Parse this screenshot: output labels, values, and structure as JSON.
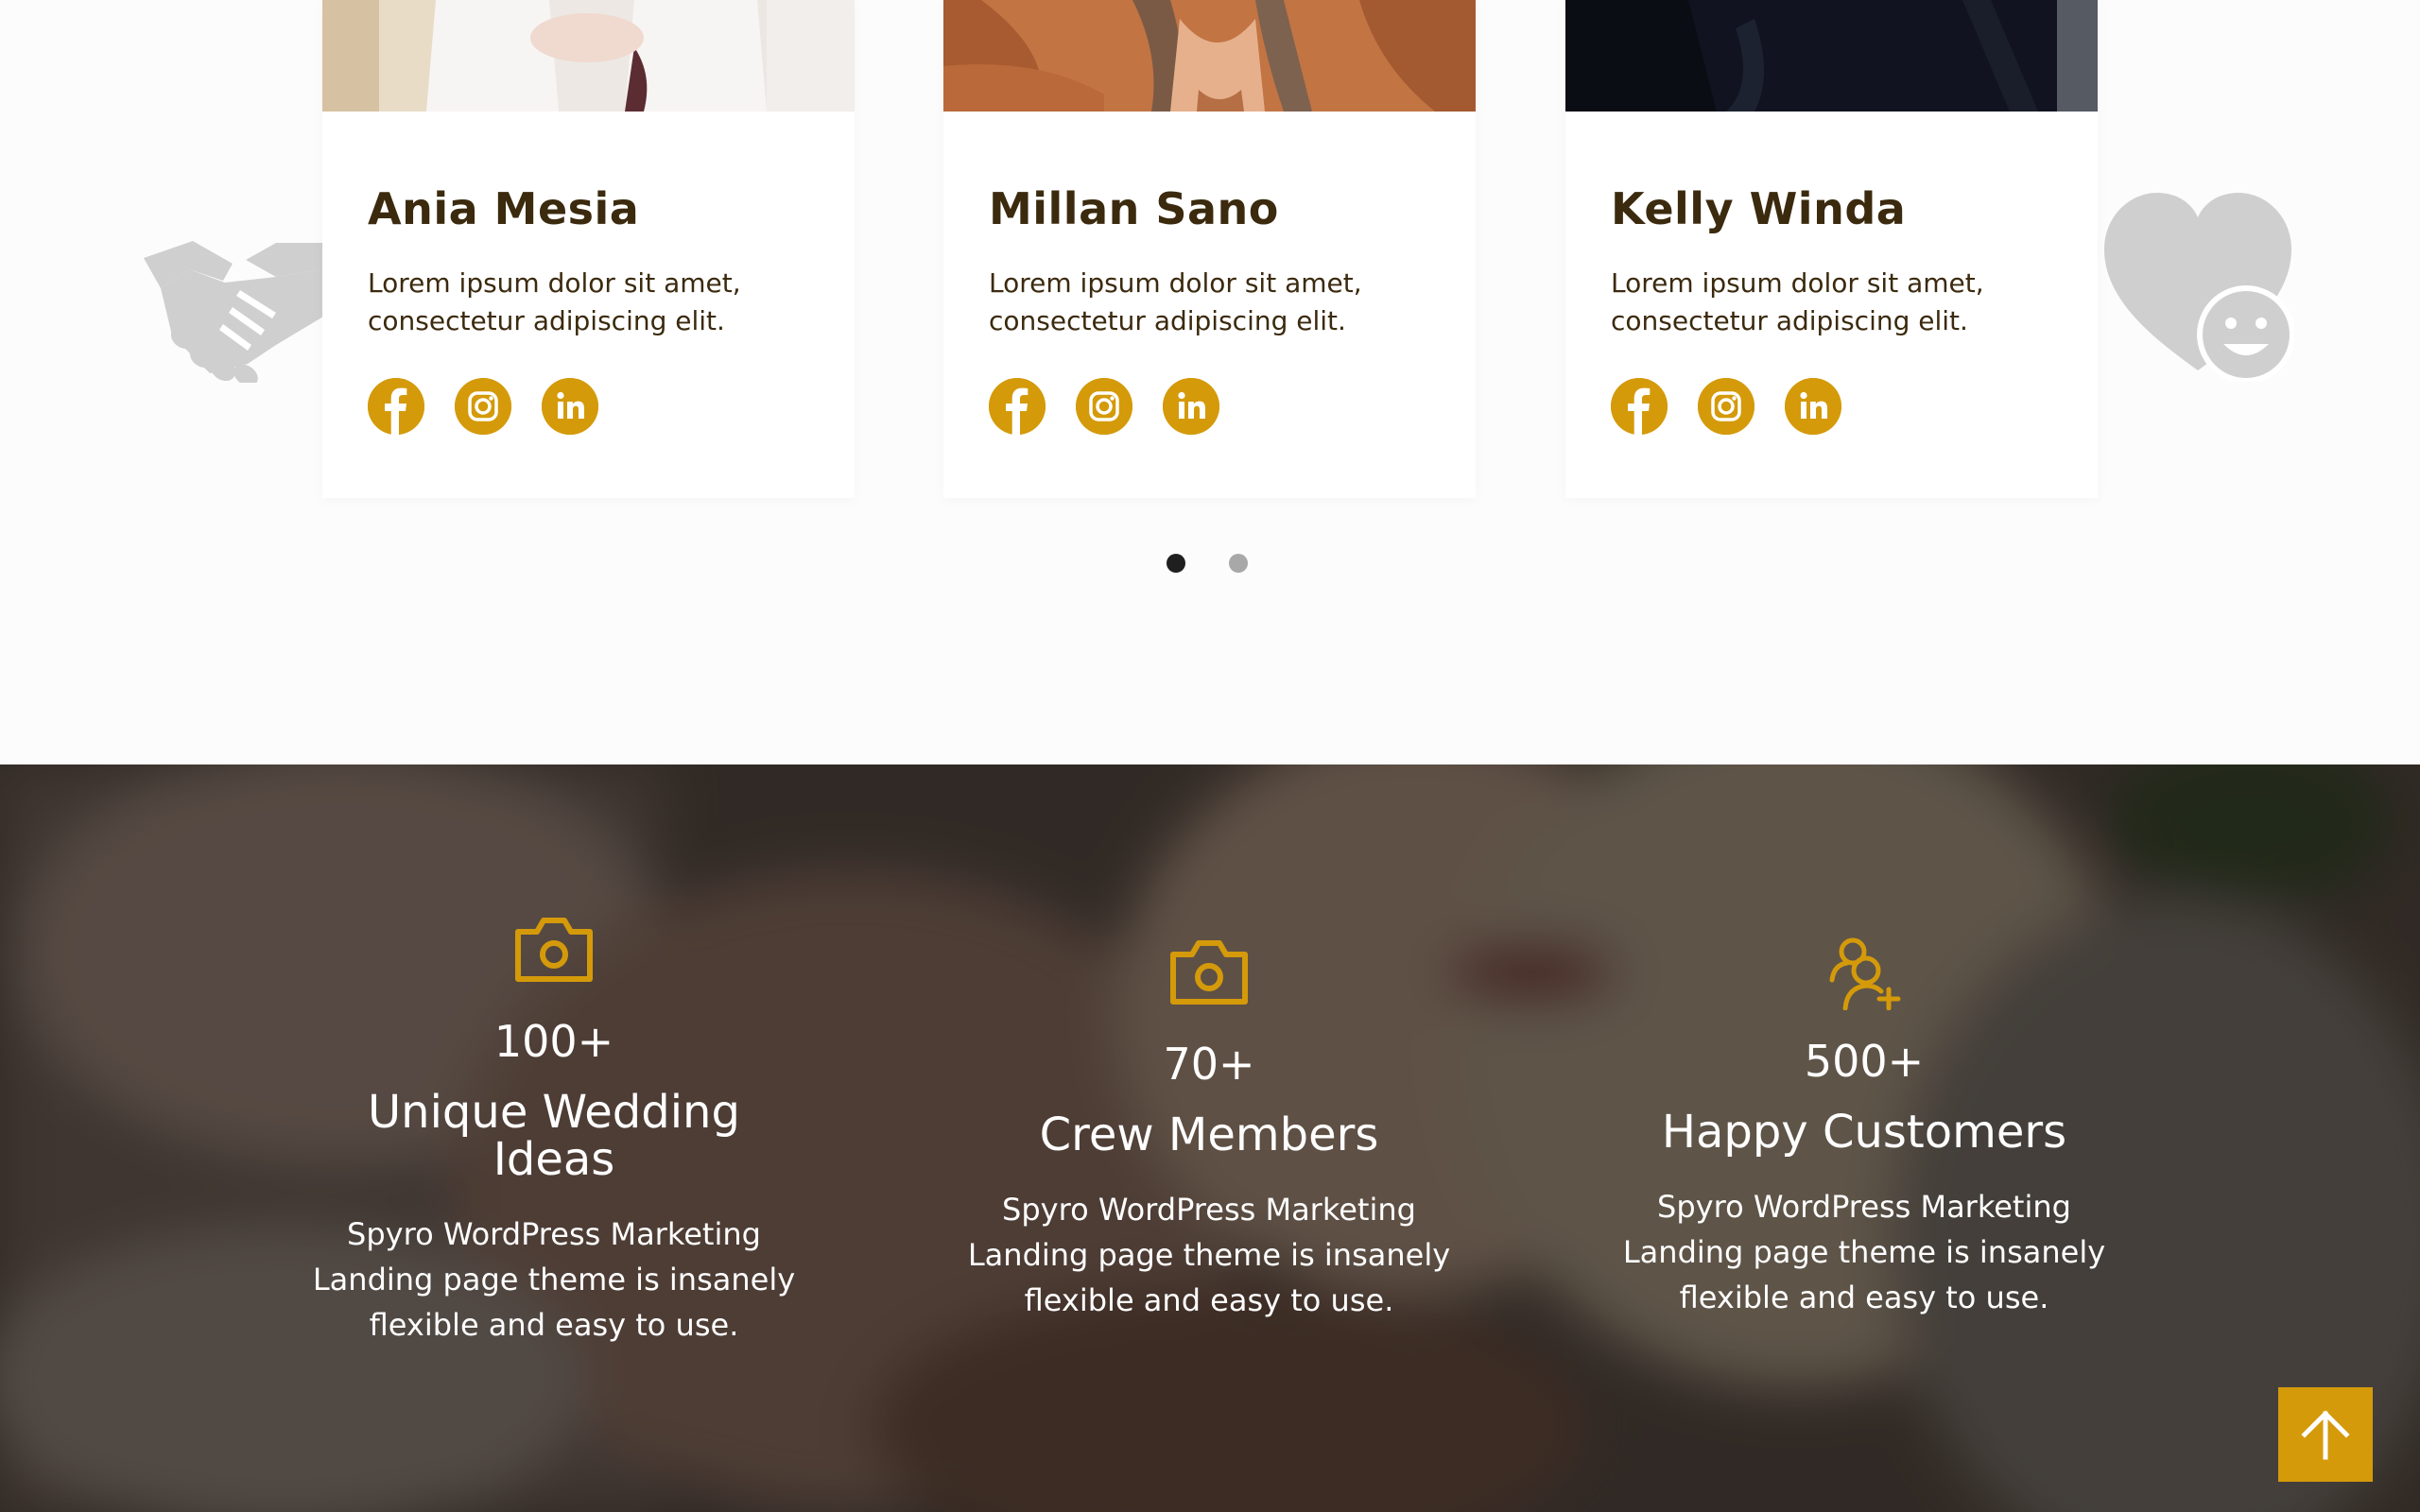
{
  "team": {
    "members": [
      {
        "name": "Ania Mesia",
        "description": "Lorem ipsum dolor sit amet, consectetur adipiscing elit."
      },
      {
        "name": "Millan Sano",
        "description": "Lorem ipsum dolor sit amet, consectetur adipiscing elit."
      },
      {
        "name": "Kelly Winda",
        "description": "Lorem ipsum dolor sit amet, consectetur adipiscing elit."
      }
    ],
    "social_icons": [
      "facebook-icon",
      "instagram-icon",
      "linkedin-icon"
    ],
    "decorations": [
      "handshake-icon",
      "heart-smile-icon"
    ],
    "slider": {
      "total_pages": 2,
      "active_page": 1
    }
  },
  "stats": {
    "items": [
      {
        "icon": "camera-icon",
        "number": "100+",
        "label": "Unique Wedding Ideas",
        "text": "Spyro WordPress Marketing Landing page theme is insanely flexible and easy to use."
      },
      {
        "icon": "camera-icon",
        "number": "70+",
        "label": "Crew Members",
        "text": "Spyro WordPress Marketing Landing page theme is insanely flexible and easy to use."
      },
      {
        "icon": "user-plus-icon",
        "number": "500+",
        "label": "Happy Customers",
        "text": "Spyro WordPress Marketing Landing page theme is insanely flexible and easy to use."
      }
    ]
  },
  "scroll_to_top_icon": "arrow-up-icon",
  "colors": {
    "accent": "#d49a0a",
    "heading": "#3b2a0e",
    "dot_active": "#1f1f1f",
    "dot_inactive": "#a8a8a8",
    "decoration": "#cfcfcf"
  }
}
